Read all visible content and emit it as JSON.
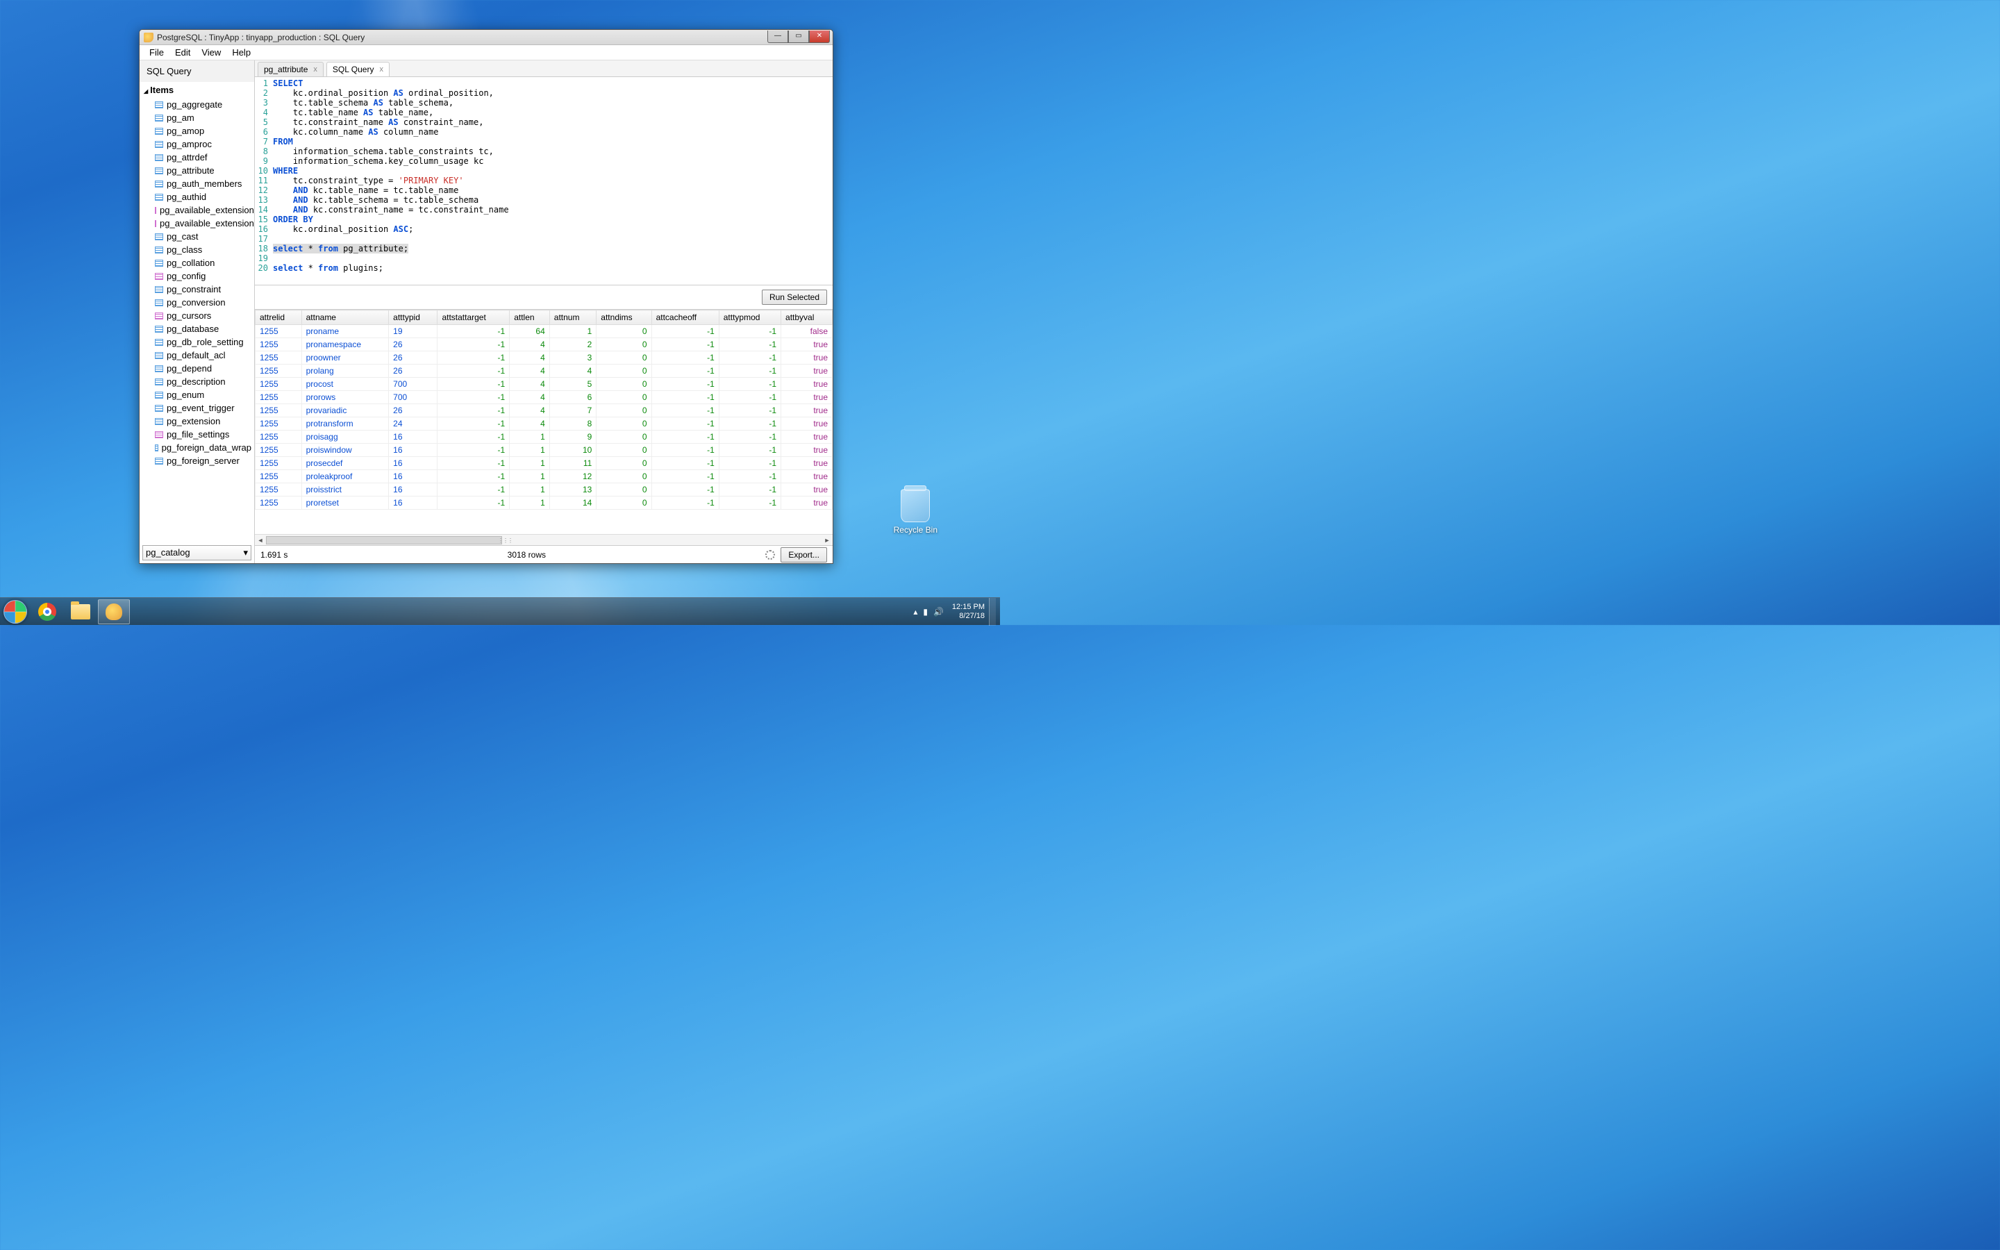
{
  "window": {
    "title": "PostgreSQL : TinyApp : tinyapp_production : SQL Query"
  },
  "menu": {
    "items": [
      "File",
      "Edit",
      "View",
      "Help"
    ]
  },
  "sidebar": {
    "title": "SQL Query",
    "items_label": "Items",
    "schema": "pg_catalog",
    "items": [
      {
        "label": "pg_aggregate",
        "k": "t"
      },
      {
        "label": "pg_am",
        "k": "t"
      },
      {
        "label": "pg_amop",
        "k": "t"
      },
      {
        "label": "pg_amproc",
        "k": "t"
      },
      {
        "label": "pg_attrdef",
        "k": "t"
      },
      {
        "label": "pg_attribute",
        "k": "t"
      },
      {
        "label": "pg_auth_members",
        "k": "t"
      },
      {
        "label": "pg_authid",
        "k": "t"
      },
      {
        "label": "pg_available_extension",
        "k": "v"
      },
      {
        "label": "pg_available_extension",
        "k": "v"
      },
      {
        "label": "pg_cast",
        "k": "t"
      },
      {
        "label": "pg_class",
        "k": "t"
      },
      {
        "label": "pg_collation",
        "k": "t"
      },
      {
        "label": "pg_config",
        "k": "v"
      },
      {
        "label": "pg_constraint",
        "k": "t"
      },
      {
        "label": "pg_conversion",
        "k": "t"
      },
      {
        "label": "pg_cursors",
        "k": "v"
      },
      {
        "label": "pg_database",
        "k": "t"
      },
      {
        "label": "pg_db_role_setting",
        "k": "t"
      },
      {
        "label": "pg_default_acl",
        "k": "t"
      },
      {
        "label": "pg_depend",
        "k": "t"
      },
      {
        "label": "pg_description",
        "k": "t"
      },
      {
        "label": "pg_enum",
        "k": "t"
      },
      {
        "label": "pg_event_trigger",
        "k": "t"
      },
      {
        "label": "pg_extension",
        "k": "t"
      },
      {
        "label": "pg_file_settings",
        "k": "v"
      },
      {
        "label": "pg_foreign_data_wrap",
        "k": "t"
      },
      {
        "label": "pg_foreign_server",
        "k": "t"
      }
    ]
  },
  "tabs": [
    {
      "label": "pg_attribute",
      "active": false
    },
    {
      "label": "SQL Query",
      "active": true
    }
  ],
  "editor": {
    "lines": [
      [
        {
          "t": "SELECT",
          "c": "kw"
        }
      ],
      [
        {
          "t": "    kc.ordinal_position "
        },
        {
          "t": "AS",
          "c": "kw"
        },
        {
          "t": " ordinal_position,"
        }
      ],
      [
        {
          "t": "    tc.table_schema "
        },
        {
          "t": "AS",
          "c": "kw"
        },
        {
          "t": " table_schema,"
        }
      ],
      [
        {
          "t": "    tc.table_name "
        },
        {
          "t": "AS",
          "c": "kw"
        },
        {
          "t": " table_name,"
        }
      ],
      [
        {
          "t": "    tc.constraint_name "
        },
        {
          "t": "AS",
          "c": "kw"
        },
        {
          "t": " constraint_name,"
        }
      ],
      [
        {
          "t": "    kc.column_name "
        },
        {
          "t": "AS",
          "c": "kw"
        },
        {
          "t": " column_name"
        }
      ],
      [
        {
          "t": "FROM",
          "c": "kw"
        }
      ],
      [
        {
          "t": "    information_schema.table_constraints tc,"
        }
      ],
      [
        {
          "t": "    information_schema.key_column_usage kc"
        }
      ],
      [
        {
          "t": "WHERE",
          "c": "kw"
        }
      ],
      [
        {
          "t": "    tc.constraint_type = "
        },
        {
          "t": "'PRIMARY KEY'",
          "c": "str"
        }
      ],
      [
        {
          "t": "    "
        },
        {
          "t": "AND",
          "c": "kw"
        },
        {
          "t": " kc.table_name = tc.table_name"
        }
      ],
      [
        {
          "t": "    "
        },
        {
          "t": "AND",
          "c": "kw"
        },
        {
          "t": " kc.table_schema = tc.table_schema"
        }
      ],
      [
        {
          "t": "    "
        },
        {
          "t": "AND",
          "c": "kw"
        },
        {
          "t": " kc.constraint_name = tc.constraint_name"
        }
      ],
      [
        {
          "t": "ORDER BY",
          "c": "kw"
        }
      ],
      [
        {
          "t": "    kc.ordinal_position "
        },
        {
          "t": "ASC",
          "c": "kw"
        },
        {
          "t": ";"
        }
      ],
      [
        {
          "t": ""
        }
      ],
      [
        {
          "t": "select",
          "c": "kw",
          "hl": true
        },
        {
          "t": " * ",
          "hl": true
        },
        {
          "t": "from",
          "c": "kw",
          "hl": true
        },
        {
          "t": " pg_attribute;",
          "hl": true
        }
      ],
      [
        {
          "t": ""
        }
      ],
      [
        {
          "t": "select",
          "c": "kw"
        },
        {
          "t": " * "
        },
        {
          "t": "from",
          "c": "kw"
        },
        {
          "t": " plugins;"
        }
      ]
    ]
  },
  "run_label": "Run Selected",
  "results": {
    "columns": [
      "attrelid",
      "attname",
      "atttypid",
      "attstattarget",
      "attlen",
      "attnum",
      "attndims",
      "attcacheoff",
      "atttypmod",
      "attbyval"
    ],
    "rows": [
      [
        "1255",
        "proname",
        "19",
        "-1",
        "64",
        "1",
        "0",
        "-1",
        "-1",
        "false"
      ],
      [
        "1255",
        "pronamespace",
        "26",
        "-1",
        "4",
        "2",
        "0",
        "-1",
        "-1",
        "true"
      ],
      [
        "1255",
        "proowner",
        "26",
        "-1",
        "4",
        "3",
        "0",
        "-1",
        "-1",
        "true"
      ],
      [
        "1255",
        "prolang",
        "26",
        "-1",
        "4",
        "4",
        "0",
        "-1",
        "-1",
        "true"
      ],
      [
        "1255",
        "procost",
        "700",
        "-1",
        "4",
        "5",
        "0",
        "-1",
        "-1",
        "true"
      ],
      [
        "1255",
        "prorows",
        "700",
        "-1",
        "4",
        "6",
        "0",
        "-1",
        "-1",
        "true"
      ],
      [
        "1255",
        "provariadic",
        "26",
        "-1",
        "4",
        "7",
        "0",
        "-1",
        "-1",
        "true"
      ],
      [
        "1255",
        "protransform",
        "24",
        "-1",
        "4",
        "8",
        "0",
        "-1",
        "-1",
        "true"
      ],
      [
        "1255",
        "proisagg",
        "16",
        "-1",
        "1",
        "9",
        "0",
        "-1",
        "-1",
        "true"
      ],
      [
        "1255",
        "proiswindow",
        "16",
        "-1",
        "1",
        "10",
        "0",
        "-1",
        "-1",
        "true"
      ],
      [
        "1255",
        "prosecdef",
        "16",
        "-1",
        "1",
        "11",
        "0",
        "-1",
        "-1",
        "true"
      ],
      [
        "1255",
        "proleakproof",
        "16",
        "-1",
        "1",
        "12",
        "0",
        "-1",
        "-1",
        "true"
      ],
      [
        "1255",
        "proisstrict",
        "16",
        "-1",
        "1",
        "13",
        "0",
        "-1",
        "-1",
        "true"
      ],
      [
        "1255",
        "proretset",
        "16",
        "-1",
        "1",
        "14",
        "0",
        "-1",
        "-1",
        "true"
      ]
    ]
  },
  "status": {
    "time": "1.691 s",
    "rows": "3018 rows",
    "export": "Export..."
  },
  "desktop": {
    "recycle": "Recycle Bin"
  },
  "clock": {
    "time": "12:15 PM",
    "date": "8/27/18"
  }
}
